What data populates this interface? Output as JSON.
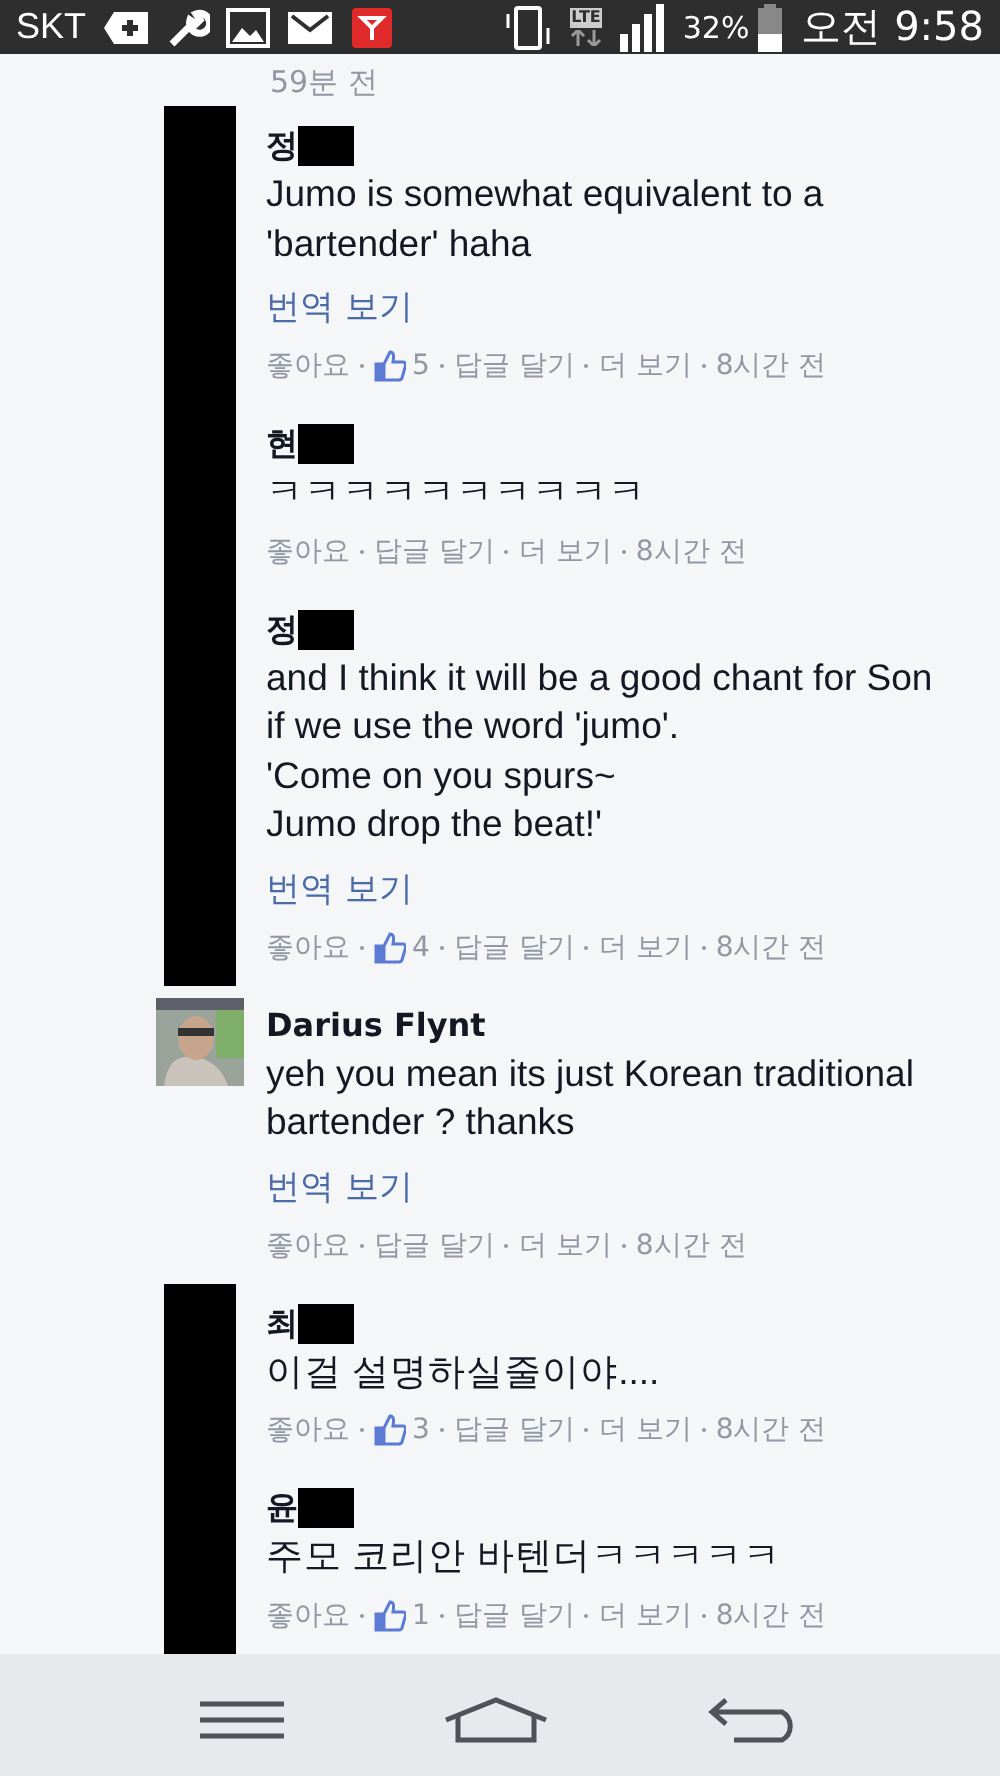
{
  "status_bar": {
    "carrier": "SKT",
    "network": "LTE",
    "battery": "32%",
    "time": "오전 9:58"
  },
  "top_time": "59분 전",
  "comments": [
    {
      "name": "정",
      "redacted": true,
      "avatar": {
        "kind": "redacted"
      },
      "body": [
        "Jumo is somewhat equivalent to a",
        "'bartender' haha"
      ],
      "translate": "번역 보기",
      "like": "좋아요",
      "likes": "5",
      "reply": "답글 달기",
      "more": "더 보기",
      "time": "8시간 전"
    },
    {
      "name": "현",
      "redacted": true,
      "avatar": {
        "kind": "redacted"
      },
      "body": [
        "ㅋㅋㅋㅋㅋㅋㅋㅋㅋㅋ"
      ],
      "like": "좋아요",
      "reply": "답글 달기",
      "more": "더 보기",
      "time": "8시간 전"
    },
    {
      "name": "정",
      "redacted": true,
      "avatar": {
        "kind": "redacted"
      },
      "body": [
        "and I think it will be a good chant for Son",
        "if we use the word 'jumo'.",
        "'Come on you spurs~",
        "Jumo drop the beat!'"
      ],
      "translate": "번역 보기",
      "like": "좋아요",
      "likes": "4",
      "reply": "답글 달기",
      "more": "더 보기",
      "time": "8시간 전"
    },
    {
      "name": "Darius Flynt",
      "redacted": false,
      "body": [
        "yeh you mean its just Korean traditional",
        "bartender ? thanks"
      ],
      "translate": "번역 보기",
      "like": "좋아요",
      "reply": "답글 달기",
      "more": "더 보기",
      "time": "8시간 전"
    },
    {
      "name": "최",
      "redacted": true,
      "avatar": {
        "kind": "redacted"
      },
      "body": [
        "이걸 설명하실줄이야...."
      ],
      "like": "좋아요",
      "likes": "3",
      "reply": "답글 달기",
      "more": "더 보기",
      "time": "8시간 전"
    },
    {
      "name": "윤",
      "redacted": true,
      "avatar": {
        "kind": "redacted"
      },
      "body": [
        "주모 코리안 바텐더ㅋㅋㅋㅋㅋ"
      ],
      "like": "좋아요",
      "likes": "1",
      "reply": "답글 달기",
      "more": "더 보기",
      "time": "8시간 전"
    }
  ]
}
